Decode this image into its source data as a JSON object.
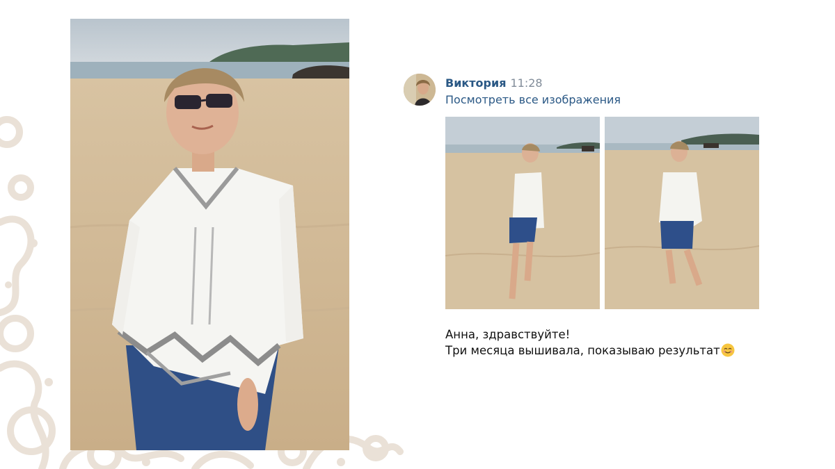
{
  "post": {
    "author": "Виктория",
    "time": "11:28",
    "view_all_link": "Посмотреть все изображения",
    "message_line1": "Анна, здравствуйте!",
    "message_line2": "Три месяца вышивала, показываю результат",
    "emoji": "smiling-face-emoji"
  },
  "images": {
    "main_photo": "woman-beach-embroidered-blouse-photo",
    "attachment_1": "woman-beach-side-view-photo",
    "attachment_2": "woman-beach-front-view-photo"
  },
  "colors": {
    "link": "#2a5885",
    "time": "#818c99",
    "text": "#111111",
    "lace_decor": "#e9e0d6",
    "sand": "#d9c6a8",
    "sky": "#c7d1da"
  }
}
